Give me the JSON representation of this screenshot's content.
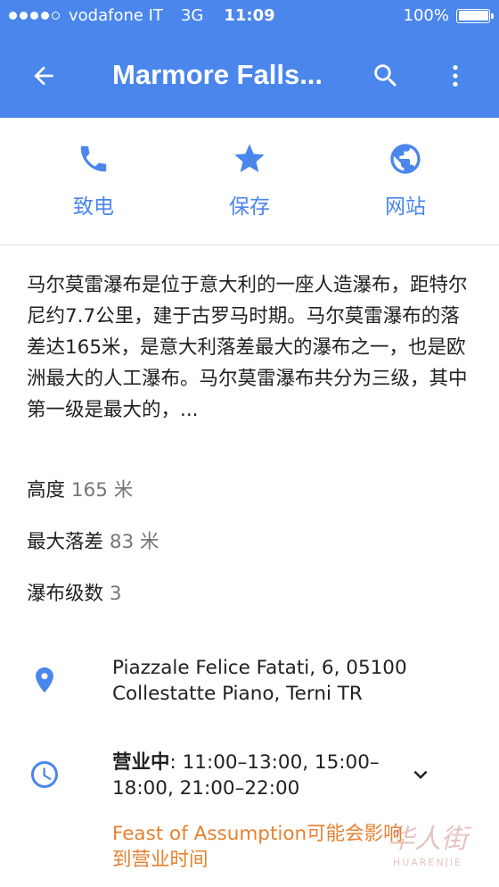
{
  "status_bar": {
    "carrier": "vodafone IT",
    "network": "3G",
    "time": "11:09",
    "battery": "100%",
    "battery_level": 1.0
  },
  "app_bar": {
    "title": "Marmore Falls...",
    "back_icon": "arrow-left-icon",
    "search_icon": "search-icon",
    "more_icon": "more-vert-icon",
    "color": "#4a86ec"
  },
  "actions": [
    {
      "label": "致电",
      "icon": "phone-icon"
    },
    {
      "label": "保存",
      "icon": "star-icon"
    },
    {
      "label": "网站",
      "icon": "globe-icon"
    }
  ],
  "description": "马尔莫雷瀑布是位于意大利的一座人造瀑布，距特尔尼约7.7公里，建于古罗马时期。马尔莫雷瀑布的落差达165米，是意大利落差最大的瀑布之一，也是欧洲最大的人工瀑布。马尔莫雷瀑布共分为三级，其中第一级是最大的，...",
  "facts": [
    {
      "key": "高度",
      "value": "165 米"
    },
    {
      "key": "最大落差",
      "value": "83 米"
    },
    {
      "key": "瀑布级数",
      "value": "3"
    }
  ],
  "address": {
    "icon": "location-pin-icon",
    "line1": "Piazzale Felice Fatati, 6, 05100",
    "line2": "Collestatte Piano, Terni TR"
  },
  "hours": {
    "icon": "clock-icon",
    "status": "营业中",
    "line1": ": 11:00–13:00, 15:00–",
    "line2": "18:00, 21:00–22:00",
    "expand_icon": "chevron-down-icon",
    "warning_line1": "Feast of Assumption可能会影响",
    "warning_line2": "到营业时间"
  },
  "watermark": {
    "text": "HUARENJIE",
    "chinese": "华人街"
  },
  "colors": {
    "accent": "#4a86ec",
    "warning": "#e6812f",
    "secondary_text": "#757575"
  }
}
